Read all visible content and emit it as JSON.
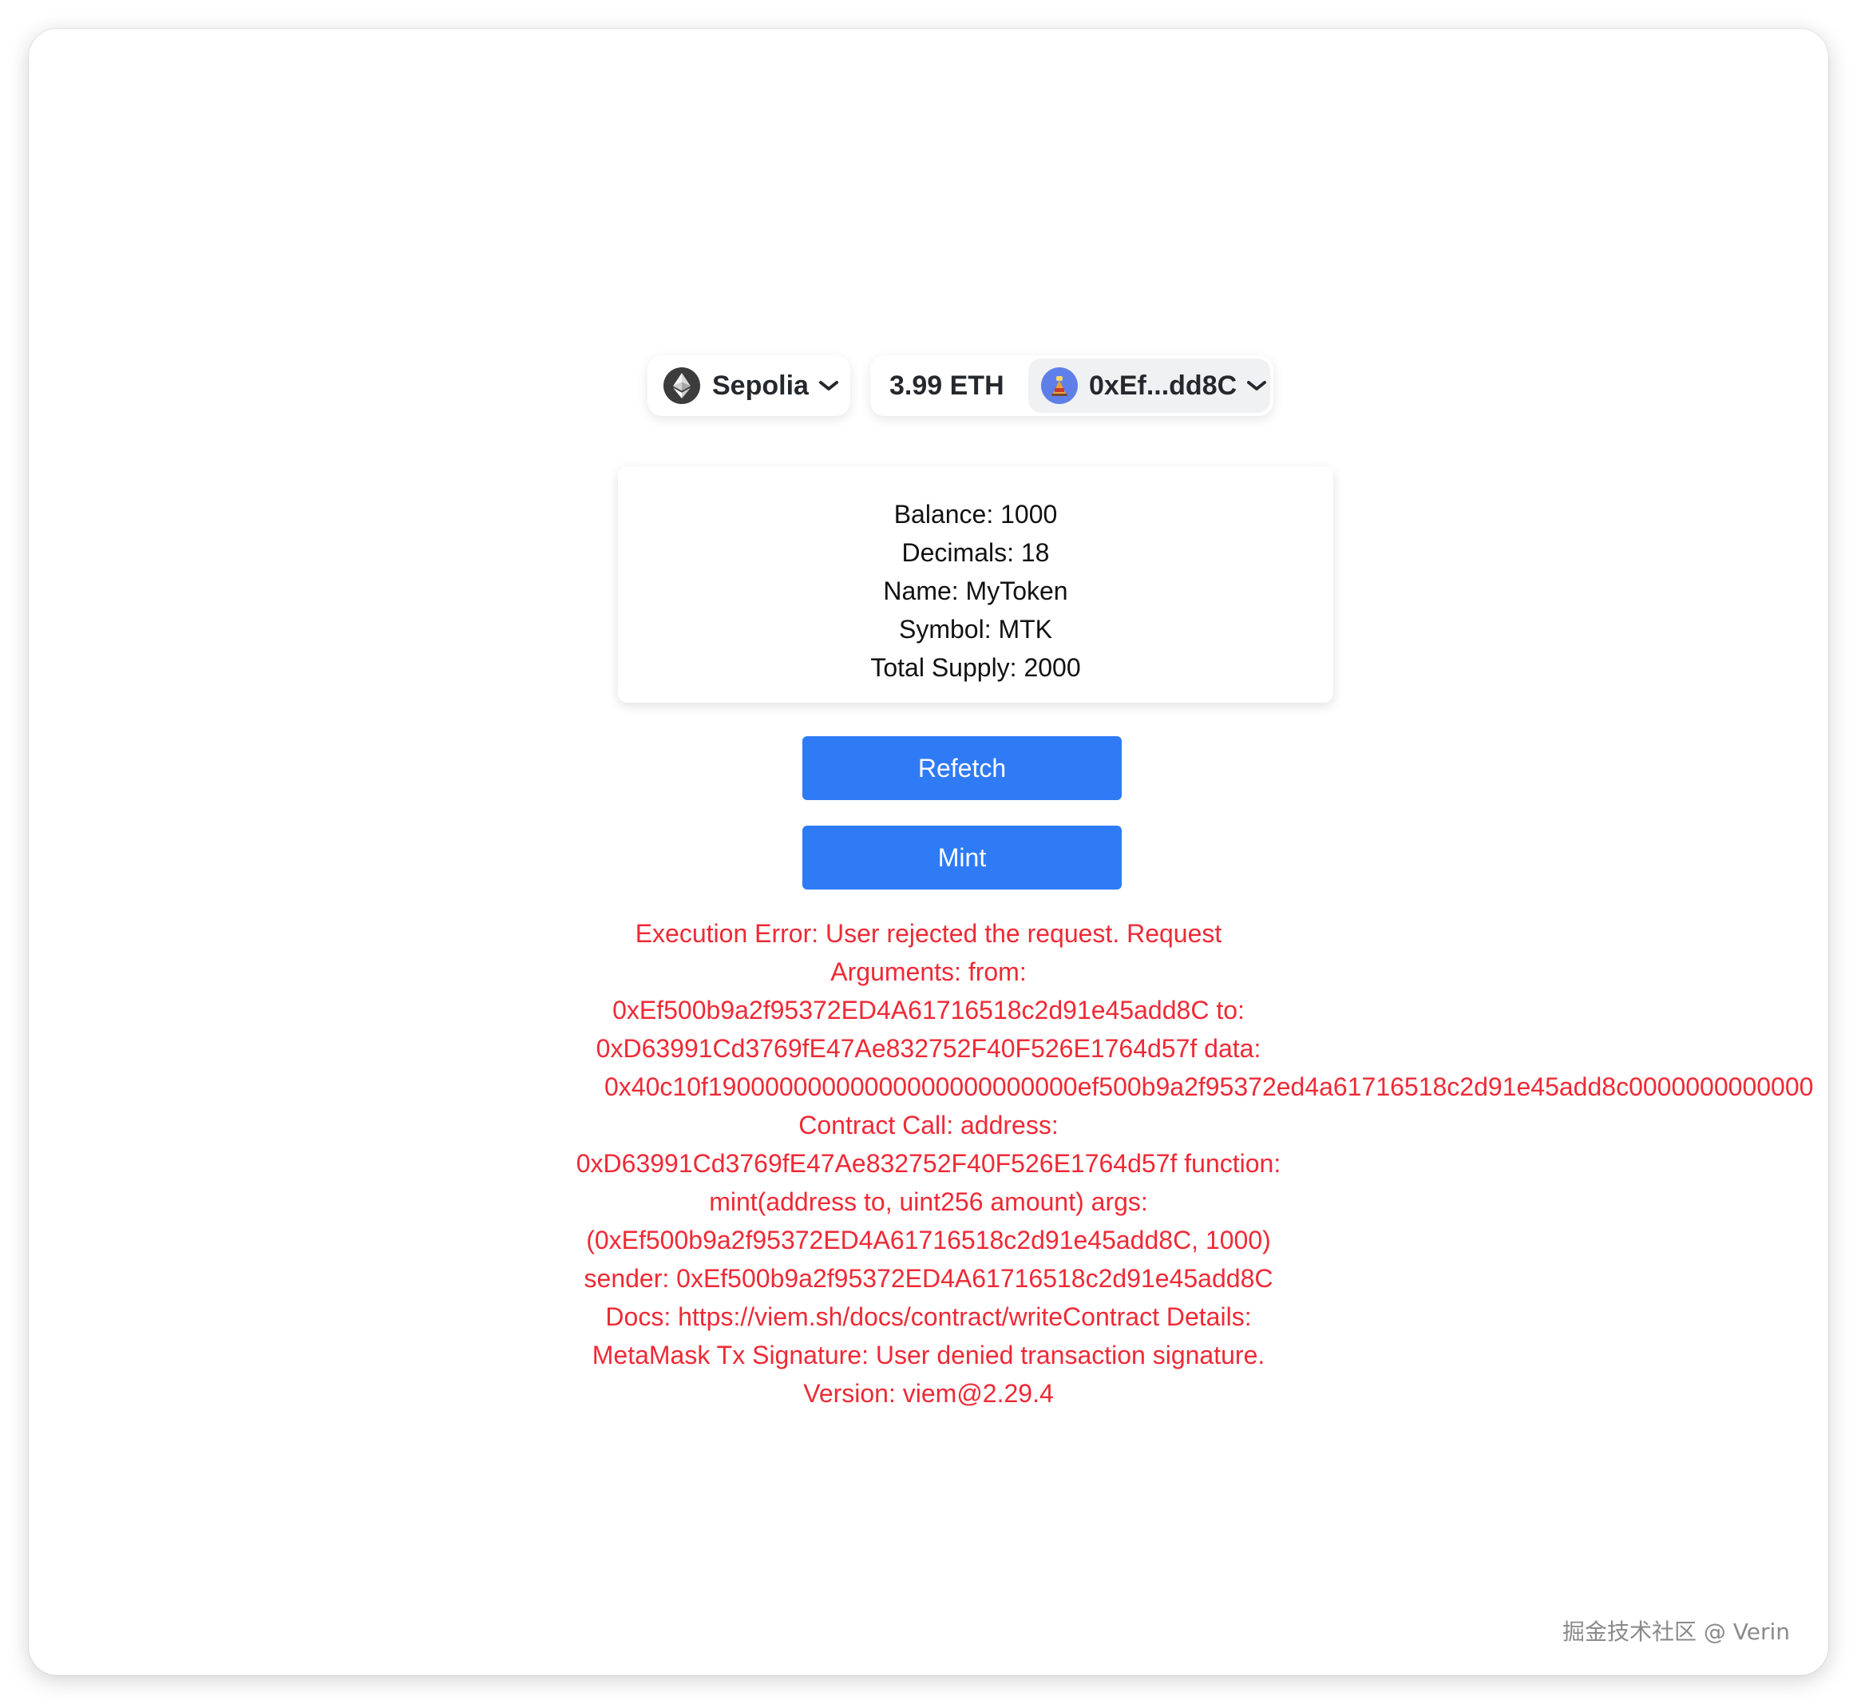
{
  "wallet": {
    "chain_label": "Sepolia",
    "balance": "3.99 ETH",
    "account_label": "0xEf...dd8C"
  },
  "token_info": {
    "balance": "Balance: 1000",
    "decimals": "Decimals: 18",
    "name": "Name: MyToken",
    "symbol": "Symbol: MTK",
    "total_supply": "Total Supply: 2000"
  },
  "buttons": {
    "refetch_label": "Refetch",
    "mint_label": "Mint"
  },
  "error": {
    "lines": [
      "Execution Error: User rejected the request. Request",
      "Arguments: from:",
      "0xEf500b9a2f95372ED4A61716518c2d91e45add8C to:",
      "0xD63991Cd3769fE47Ae832752F40F526E1764d57f data:",
      "0x40c10f19000000000000000000000000ef500b9a2f95372ed4a61716518c2d91e45add8c0000000000000",
      "Contract Call: address:",
      "0xD63991Cd3769fE47Ae832752F40F526E1764d57f function:",
      "mint(address to, uint256 amount) args:",
      "(0xEf500b9a2f95372ED4A61716518c2d91e45add8C, 1000)",
      "sender: 0xEf500b9a2f95372ED4A61716518c2d91e45add8C",
      "Docs: https://viem.sh/docs/contract/writeContract Details:",
      "MetaMask Tx Signature: User denied transaction signature.",
      "Version: viem@2.29.4"
    ]
  },
  "icons": {
    "chain": "ethereum-icon",
    "avatar": "account-avatar-icon",
    "dropdown": "chevron-down-icon"
  },
  "colors": {
    "button_blue": "#2f7bf6",
    "error_red": "#ee2a36",
    "text_dark": "#25292e",
    "avatar_blue": "#5f7fe8"
  },
  "watermark": "掘金技术社区 @ Verin"
}
